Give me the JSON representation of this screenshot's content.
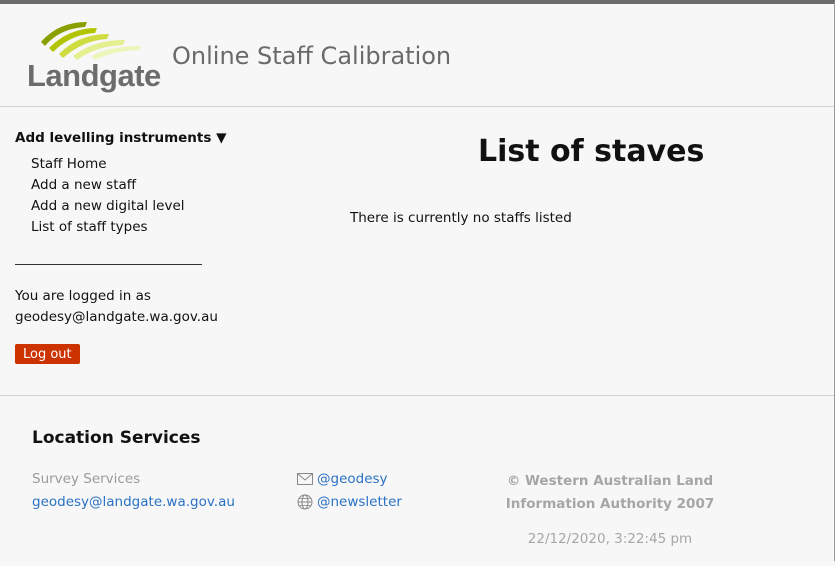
{
  "header": {
    "logo_text": "Landgate",
    "app_title": "Online Staff Calibration"
  },
  "sidebar": {
    "menu_heading": "Add levelling instruments ▼",
    "items": [
      {
        "label": "Staff Home"
      },
      {
        "label": "Add a new staff"
      },
      {
        "label": "Add a new digital level"
      },
      {
        "label": "List of staff types"
      }
    ],
    "login_line1": "You are logged in as",
    "login_email": "geodesy@landgate.wa.gov.au",
    "logout_label": "Log out"
  },
  "main": {
    "title": "List of staves",
    "empty_message": "There is currently no staffs listed"
  },
  "footer": {
    "heading": "Location Services",
    "org": "Survey Services",
    "email": "geodesy@landgate.wa.gov.au",
    "social": [
      {
        "icon": "envelope-icon",
        "label": "@geodesy"
      },
      {
        "icon": "globe-icon",
        "label": "@newsletter"
      }
    ],
    "copyright": "© Western Australian Land Information Authority 2007",
    "timestamp": "22/12/2020, 3:22:45 pm"
  },
  "colors": {
    "accent_logout": "#cc3300",
    "link": "#2a72c4",
    "logo_green_dark": "#8aa000",
    "logo_green_light": "#e4ef90",
    "muted_text": "#a6a6a6"
  }
}
